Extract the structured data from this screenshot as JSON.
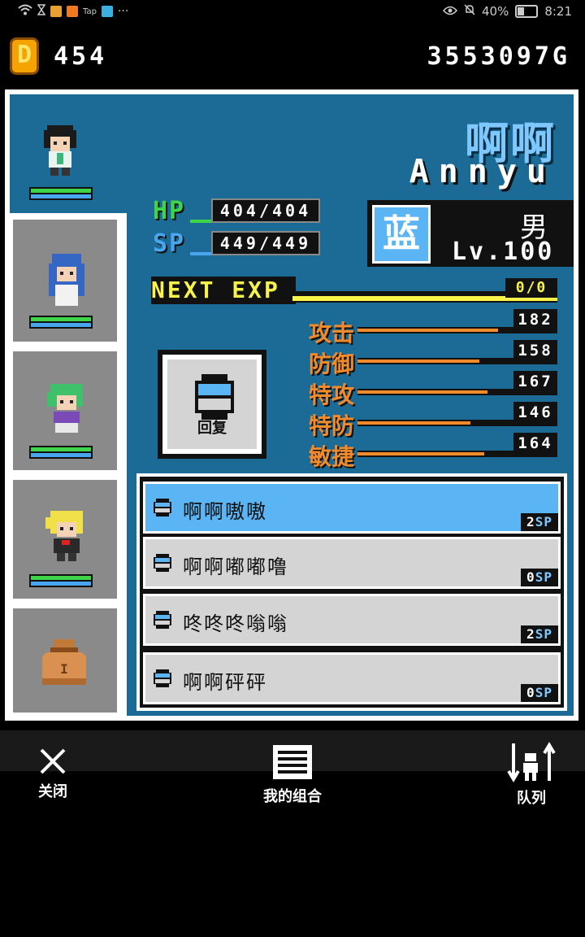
{
  "status_bar": {
    "right_percent": "40%",
    "time": "8:21",
    "battery_level": 0.4
  },
  "top": {
    "coins": "454",
    "gold": "3553097G"
  },
  "character": {
    "name_cn": "啊啊",
    "name_en": "Annyu",
    "type": "蓝",
    "gender": "男",
    "level": "Lv.100",
    "hp_label": "HP",
    "hp": "404/404",
    "sp_label": "SP",
    "sp": "449/449",
    "next_exp_label": "NEXT EXP",
    "next_exp": "0/0"
  },
  "attributes": [
    {
      "label": "攻击",
      "value": "182",
      "fill": 0.91
    },
    {
      "label": "防御",
      "value": "158",
      "fill": 0.79
    },
    {
      "label": "特攻",
      "value": "167",
      "fill": 0.84
    },
    {
      "label": "特防",
      "value": "146",
      "fill": 0.73
    },
    {
      "label": "敏捷",
      "value": "164",
      "fill": 0.82
    }
  ],
  "recover_label": "回复",
  "skills": [
    {
      "name": "啊啊嗷嗷",
      "sp": "2",
      "unit": "SP",
      "active": true
    },
    {
      "name": "啊啊嘟嘟噜",
      "sp": "0",
      "unit": "SP",
      "active": false
    },
    {
      "name": "咚咚咚嗡嗡",
      "sp": "2",
      "unit": "SP",
      "active": false
    },
    {
      "name": "啊啊砰砰",
      "sp": "0",
      "unit": "SP",
      "active": false
    }
  ],
  "nav": {
    "close": "关闭",
    "combo": "我的组合",
    "order": "队列"
  },
  "colors": {
    "panel_bg": "#1b6b96",
    "hp_green": "#3fd44a",
    "sp_blue": "#4aa5ef",
    "attr_orange": "#f08a2a",
    "exp_yellow": "#f7f34a",
    "active_skill": "#5bb4f3"
  }
}
